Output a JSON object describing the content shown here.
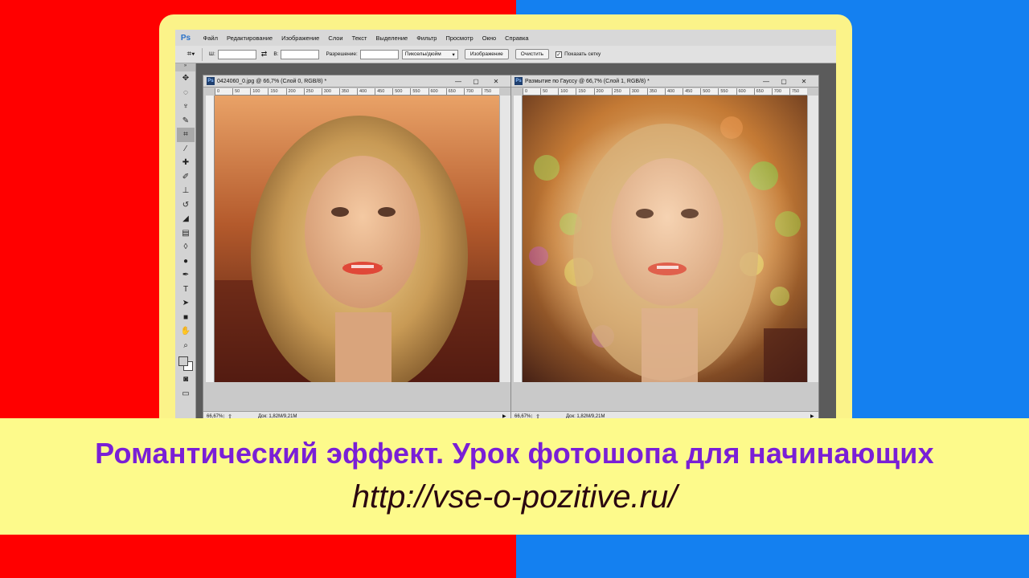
{
  "colors": {
    "left_bg": "#ff0000",
    "right_bg": "#1480f0",
    "frame": "#fbf389",
    "title_color": "#7a1fd6"
  },
  "app": {
    "logo": "Ps",
    "menu": [
      "Файл",
      "Редактирование",
      "Изображение",
      "Слои",
      "Текст",
      "Выделение",
      "Фильтр",
      "Просмотр",
      "Окно",
      "Справка"
    ]
  },
  "options": {
    "width_label": "Ш:",
    "height_label": "В:",
    "resolution_label": "Разрешение:",
    "units_value": "Пикселы/дюйм",
    "image_button": "Изображение",
    "clear_button": "Очистить",
    "grid_checkbox_label": "Показать сетку",
    "grid_checked": true
  },
  "doc1": {
    "title": "0424060_0.jpg @ 66,7% (Слой 0, RGB/8) *",
    "zoom": "66,67%",
    "info": "Док: 1,82М/9,21М"
  },
  "doc2": {
    "title": "Размытие по Гауссу @ 66,7% (Слой 1, RGB/8) *",
    "zoom": "66,67%",
    "info": "Док: 1,82М/9,21М"
  },
  "ruler_ticks": [
    "0",
    "50",
    "100",
    "150",
    "200",
    "250",
    "300",
    "350",
    "400",
    "450",
    "500",
    "550",
    "600",
    "650",
    "700",
    "750"
  ],
  "caption": {
    "title": "Романтический эффект. Урок фотошопа для начинающих",
    "url": "http://vse-o-pozitive.ru/"
  }
}
